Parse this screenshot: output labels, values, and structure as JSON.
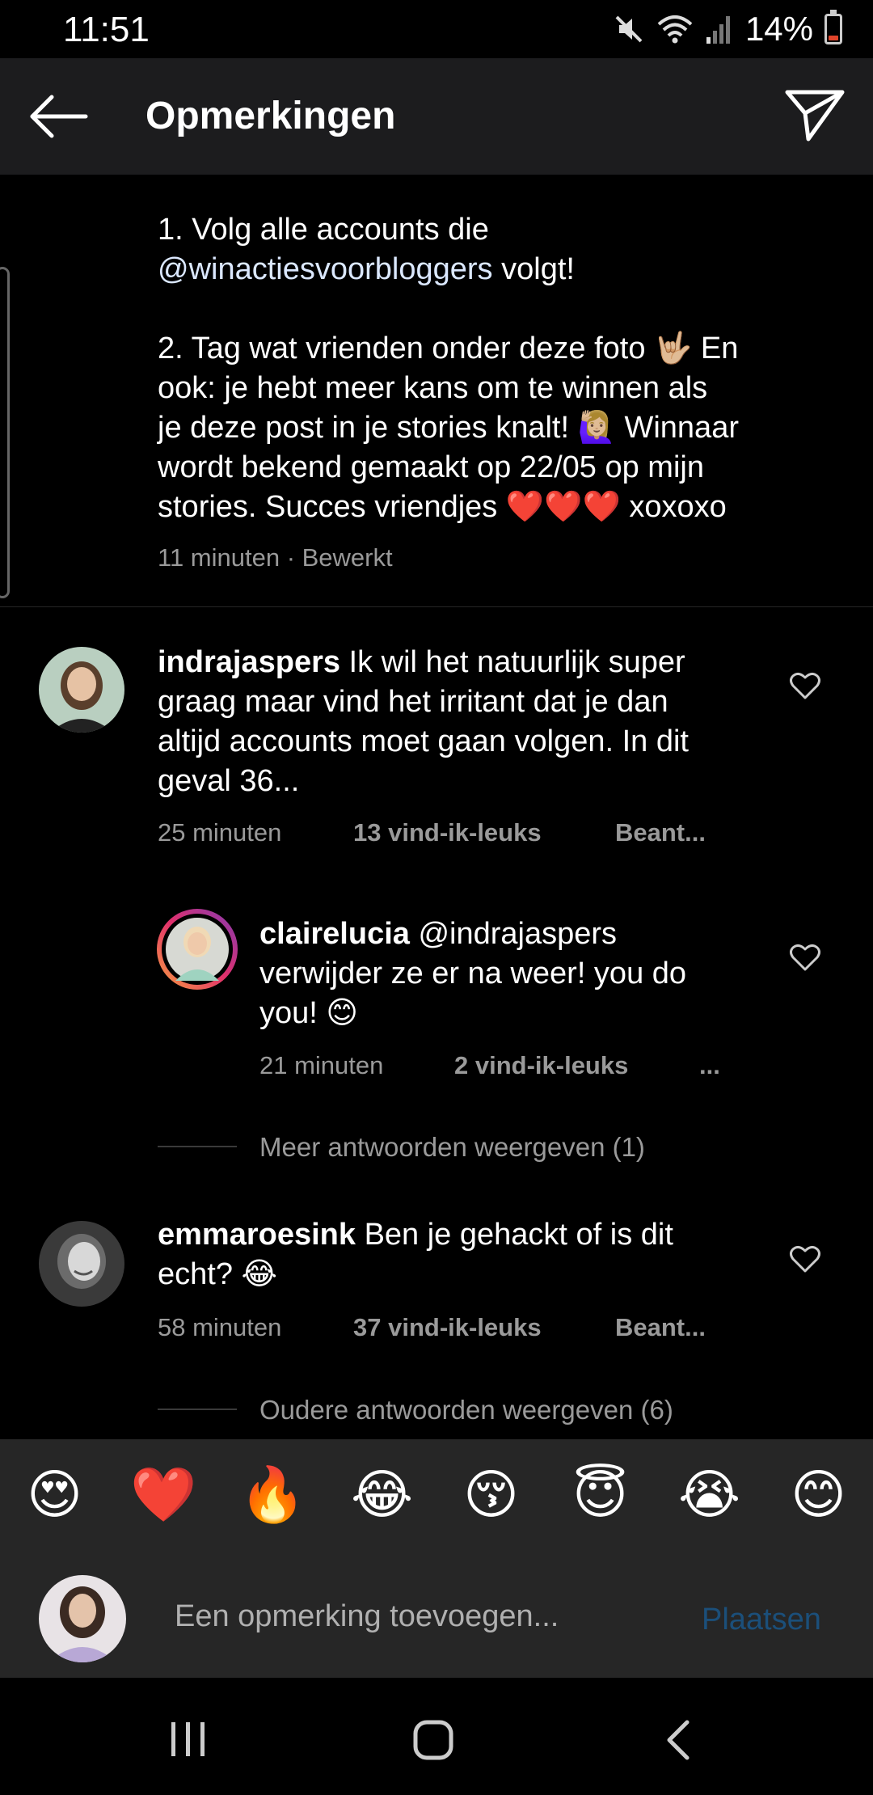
{
  "status": {
    "time": "11:51",
    "battery": "14%"
  },
  "header": {
    "title": "Opmerkingen"
  },
  "caption": {
    "line1": "1. Volg alle accounts die",
    "mention": "@winactiesvoorbloggers",
    "line2_suffix": " volgt!",
    "paragraph2_lines": [
      "2. Tag wat vrienden onder deze foto 🤟🏼 En",
      "ook: je hebt meer kans om te winnen als",
      "je deze post in je stories knalt! 🙋🏼‍♀️ Winnaar",
      "wordt bekend gemaakt op 22/05 op mijn",
      "stories. Succes vriendjes ❤️❤️❤️ xoxoxo"
    ],
    "meta": "11 minuten · Bewerkt"
  },
  "comments": [
    {
      "username": "indrajaspers",
      "text_lines": [
        " Ik wil het natuurlijk super",
        "graag maar vind het irritant dat je dan",
        "altijd accounts moet gaan volgen. In dit",
        "geval 36..."
      ],
      "time": "25 minuten",
      "likes": "13 vind-ik-leuks",
      "reply": "Beant..."
    },
    {
      "username": "clairelucia",
      "text_lines": [
        " @indrajaspers",
        "verwijder ze er na weer! you do",
        "you! 😊"
      ],
      "time": "21 minuten",
      "likes": "2 vind-ik-leuks",
      "reply": "..."
    },
    {
      "username": "emmaroesink",
      "text_lines": [
        " Ben je gehackt of is dit",
        "echt? 😂"
      ],
      "time": "58 minuten",
      "likes": "37 vind-ik-leuks",
      "reply": "Beant..."
    }
  ],
  "more_replies": "Meer antwoorden weergeven (1)",
  "older_replies": "Oudere antwoorden weergeven (6)",
  "emoji_bar": [
    "😍",
    "❤️",
    "🔥",
    "😂",
    "😚",
    "😇",
    "😭",
    "😊"
  ],
  "input": {
    "placeholder": "Een opmerking toevoegen...",
    "post_label": "Plaatsen"
  },
  "colors": {
    "background": "#000000",
    "header": "#1c1c1e",
    "muted_text": "#9a9a9a",
    "post_button": "#1b4f7a",
    "story_ring": "#e1306c"
  }
}
